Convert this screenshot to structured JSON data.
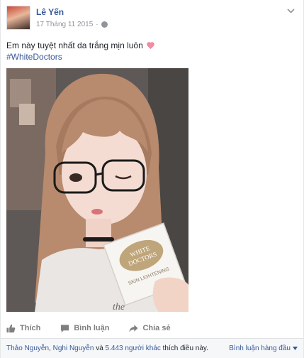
{
  "post": {
    "author": "Lê Yến",
    "date": "17 Tháng 11 2015",
    "separator": "·",
    "text": "Em này tuyệt nhất da trắng mịn luôn",
    "hashtag": "#WhiteDoctors",
    "product_brand_line1": "WHITE",
    "product_brand_line2": "DOCTORS",
    "product_sub": "SKIN LIGHTENING",
    "shirt_text": "the"
  },
  "actions": {
    "like": "Thích",
    "comment": "Bình luận",
    "share": "Chia sẻ"
  },
  "footer": {
    "liker1": "Thảo Nguyễn",
    "sep": ", ",
    "liker2": "Nghi Nguyễn",
    "and": " và ",
    "others": "5.443 người khác",
    "likes_this": " thích điều này.",
    "sort": "Bình luận hàng đầu"
  },
  "colors": {
    "link": "#365899",
    "meta": "#90949c",
    "footer_bg": "#f6f7f9"
  }
}
